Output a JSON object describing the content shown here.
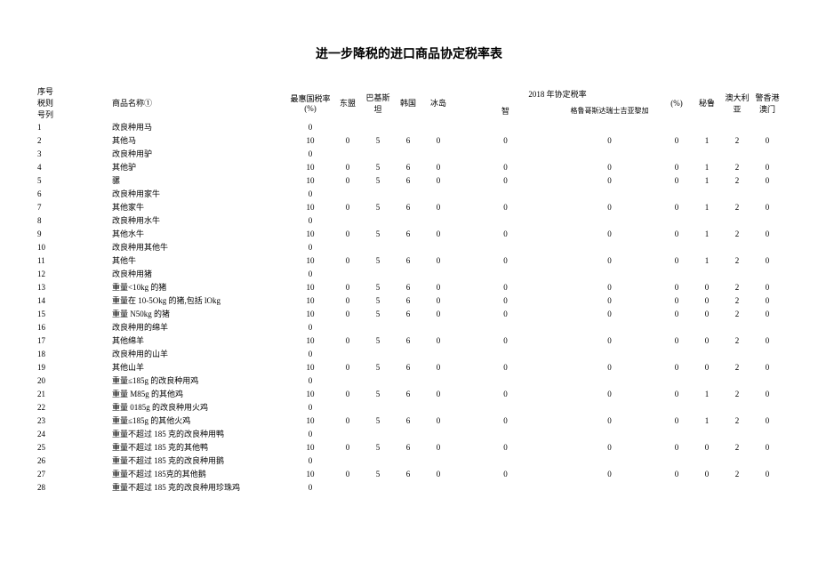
{
  "title": "进一步降税的进口商品协定税率表",
  "headers": {
    "idx_code": "序号税则号列",
    "name": "商品名称①",
    "mfn": "最惠国税率 (%)",
    "group2018": "2018 年协定税率",
    "pct": "(%)",
    "cols": [
      "东盟",
      "巴基斯坦",
      "韩国",
      "冰岛",
      "智",
      "格鲁哥斯达瑞士吉亚黎加",
      "秘鲁",
      "澳大利亚",
      "警香港澳门"
    ]
  },
  "rows": [
    {
      "idx": "1",
      "name": "改良种用马",
      "mfn": "0",
      "v": [
        "",
        "",
        "",
        "",
        "",
        "",
        "",
        "",
        "",
        "",
        ""
      ]
    },
    {
      "idx": "2",
      "name": "其他马",
      "mfn": "10",
      "v": [
        "0",
        "5",
        "6",
        "0",
        "0",
        "0",
        "0",
        "1",
        "2",
        "0",
        ""
      ]
    },
    {
      "idx": "3",
      "name": "改良种用驴",
      "mfn": "0",
      "v": [
        "",
        "",
        "",
        "",
        "",
        "",
        "",
        "",
        "",
        "",
        ""
      ]
    },
    {
      "idx": "4",
      "name": "其他驴",
      "mfn": "10",
      "v": [
        "0",
        "5",
        "6",
        "0",
        "0",
        "0",
        "0",
        "1",
        "2",
        "0",
        ""
      ]
    },
    {
      "idx": "5",
      "name": "骡",
      "mfn": "10",
      "v": [
        "0",
        "5",
        "6",
        "0",
        "0",
        "0",
        "0",
        "1",
        "2",
        "0",
        ""
      ]
    },
    {
      "idx": "6",
      "name": "改良种用家牛",
      "mfn": "0",
      "v": [
        "",
        "",
        "",
        "",
        "",
        "",
        "",
        "",
        "",
        "",
        ""
      ]
    },
    {
      "idx": "7",
      "name": "其他家牛",
      "mfn": "10",
      "v": [
        "0",
        "5",
        "6",
        "0",
        "0",
        "0",
        "0",
        "1",
        "2",
        "0",
        ""
      ]
    },
    {
      "idx": "8",
      "name": "改良种用水牛",
      "mfn": "0",
      "v": [
        "",
        "",
        "",
        "",
        "",
        "",
        "",
        "",
        "",
        "",
        ""
      ]
    },
    {
      "idx": "9",
      "name": "其他水牛",
      "mfn": "10",
      "v": [
        "0",
        "5",
        "6",
        "0",
        "0",
        "0",
        "0",
        "1",
        "2",
        "0",
        ""
      ]
    },
    {
      "idx": "10",
      "name": "改良种用其他牛",
      "mfn": "0",
      "v": [
        "",
        "",
        "",
        "",
        "",
        "",
        "",
        "",
        "",
        "",
        ""
      ]
    },
    {
      "idx": "11",
      "name": "其他牛",
      "mfn": "10",
      "v": [
        "0",
        "5",
        "6",
        "0",
        "0",
        "0",
        "0",
        "1",
        "2",
        "0",
        ""
      ]
    },
    {
      "idx": "12",
      "name": "改良种用猪",
      "mfn": "0",
      "v": [
        "",
        "",
        "",
        "",
        "",
        "",
        "",
        "",
        "",
        "",
        ""
      ]
    },
    {
      "idx": "13",
      "name": "重量<10kg 的猪",
      "mfn": "10",
      "v": [
        "0",
        "5",
        "6",
        "0",
        "0",
        "0",
        "0",
        "0",
        "2",
        "0",
        ""
      ]
    },
    {
      "idx": "14",
      "name": "重量在 10-5Okg 的猪,包括 lOkg",
      "mfn": "10",
      "v": [
        "0",
        "5",
        "6",
        "0",
        "0",
        "0",
        "0",
        "0",
        "2",
        "0",
        ""
      ]
    },
    {
      "idx": "15",
      "name": "重量 N50kg 的猪",
      "mfn": "10",
      "v": [
        "0",
        "5",
        "6",
        "0",
        "0",
        "0",
        "0",
        "0",
        "2",
        "0",
        ""
      ]
    },
    {
      "idx": "16",
      "name": "改良种用的绵羊",
      "mfn": "0",
      "v": [
        "",
        "",
        "",
        "",
        "",
        "",
        "",
        "",
        "",
        "",
        ""
      ]
    },
    {
      "idx": "17",
      "name": "其他绵羊",
      "mfn": "10",
      "v": [
        "0",
        "5",
        "6",
        "0",
        "0",
        "0",
        "0",
        "0",
        "2",
        "0",
        ""
      ]
    },
    {
      "idx": "18",
      "name": "改良种用的山羊",
      "mfn": "0",
      "v": [
        "",
        "",
        "",
        "",
        "",
        "",
        "",
        "",
        "",
        "",
        ""
      ]
    },
    {
      "idx": "19",
      "name": "其他山羊",
      "mfn": "10",
      "v": [
        "0",
        "5",
        "6",
        "0",
        "0",
        "0",
        "0",
        "0",
        "2",
        "0",
        ""
      ]
    },
    {
      "idx": "20",
      "name": "重量≤185g 的改良种用鸡",
      "mfn": "0",
      "v": [
        "",
        "",
        "",
        "",
        "",
        "",
        "",
        "",
        "",
        "",
        ""
      ]
    },
    {
      "idx": "21",
      "name": "重量 M85g 的其他鸡",
      "mfn": "10",
      "v": [
        "0",
        "5",
        "6",
        "0",
        "0",
        "0",
        "0",
        "1",
        "2",
        "0",
        ""
      ]
    },
    {
      "idx": "22",
      "name": "重量 0185g 的改良种用火鸡",
      "mfn": "0",
      "v": [
        "",
        "",
        "",
        "",
        "",
        "",
        "",
        "",
        "",
        "",
        ""
      ]
    },
    {
      "idx": "23",
      "name": "重量≤185g 的其他火鸡",
      "mfn": "10",
      "v": [
        "0",
        "5",
        "6",
        "0",
        "0",
        "0",
        "0",
        "1",
        "2",
        "0",
        ""
      ]
    },
    {
      "idx": "24",
      "name": "重量不超过 185 克的改良种用鸭",
      "mfn": "0",
      "v": [
        "",
        "",
        "",
        "",
        "",
        "",
        "",
        "",
        "",
        "",
        ""
      ]
    },
    {
      "idx": "25",
      "name": "重量不超过 185 克的其他鸭",
      "mfn": "10",
      "v": [
        "0",
        "5",
        "6",
        "0",
        "0",
        "0",
        "0",
        "0",
        "2",
        "0",
        ""
      ]
    },
    {
      "idx": "26",
      "name": "重量不超过 185 克的改良种用鹅",
      "mfn": "0",
      "v": [
        "",
        "",
        "",
        "",
        "",
        "",
        "",
        "",
        "",
        "",
        ""
      ]
    },
    {
      "idx": "27",
      "name": "重量不超过 185克的其他鹅",
      "mfn": "10",
      "v": [
        "0",
        "5",
        "6",
        "0",
        "0",
        "0",
        "0",
        "0",
        "2",
        "0",
        ""
      ]
    },
    {
      "idx": "28",
      "name": "重量不超过 185 克的改良种用珍珠鸡",
      "mfn": "0",
      "v": [
        "",
        "",
        "",
        "",
        "",
        "",
        "",
        "",
        "",
        "",
        ""
      ]
    }
  ]
}
